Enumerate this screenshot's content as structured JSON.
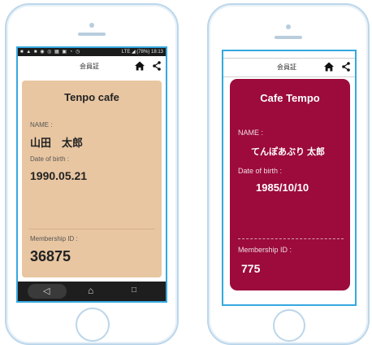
{
  "phone1": {
    "status": {
      "left_icons": "■ ▲ ■ ◉ ◎ ▦ ▣ ◔ ◷",
      "right_text": "LTE ◢ (78%) 18:13"
    },
    "header": {
      "title": "会員証"
    },
    "card": {
      "bg_color": "#e8c6a1",
      "title": "Tenpo cafe",
      "name_label": "NAME :",
      "name_value": "山田　太郎",
      "dob_label": "Date of birth :",
      "dob_value": "1990.05.21",
      "membership_label": "Membership ID :",
      "membership_value": "36875"
    },
    "navbar": {
      "back_icon": "◁",
      "home_icon": "⌂",
      "recents_icon": "□"
    }
  },
  "phone2": {
    "header": {
      "title": "会員証"
    },
    "card": {
      "bg_color": "#9c0b3c",
      "title": "Cafe  Tempo",
      "name_label": "NAME :",
      "name_value": "てんぽあぶり 太郎",
      "dob_label": "Date of birth :",
      "dob_value": "1985/10/10",
      "membership_label": "Membership ID :",
      "membership_value": "775"
    }
  }
}
